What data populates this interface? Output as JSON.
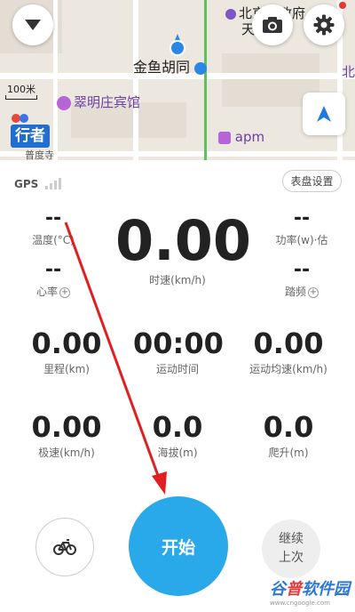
{
  "map": {
    "pois": {
      "beijing_gov": "北京市政府",
      "tianan": "天",
      "jinyu_hutong": "金鱼胡同",
      "cuiming_hotel": "翠明庄宾馆",
      "apm": "apm",
      "bei": "北",
      "puqian": "普度寺"
    },
    "scale": "100米",
    "logo": "行者",
    "icons": {
      "menu": "dropdown-arrow-icon",
      "camera": "camera-icon",
      "settings": "gear-icon",
      "locate": "navigation-arrow-icon",
      "location": "location-pin-icon"
    }
  },
  "panel": {
    "gps_label": "GPS",
    "dial_settings": "表盘设置",
    "metrics": {
      "temperature": {
        "value": "--",
        "label": "温度(°C)"
      },
      "heart_rate": {
        "value": "--",
        "label": "心率"
      },
      "speed": {
        "value": "0.00",
        "label": "时速(km/h)"
      },
      "power": {
        "value": "--",
        "label": "功率(w)·估"
      },
      "cadence": {
        "value": "--",
        "label": "踏频"
      },
      "distance": {
        "value": "0.00",
        "label": "里程(km)"
      },
      "moving_time": {
        "value": "00:00",
        "label": "运动时间"
      },
      "avg_speed": {
        "value": "0.00",
        "label": "运动均速(km/h)"
      },
      "max_speed": {
        "value": "0.00",
        "label": "极速(km/h)"
      },
      "altitude": {
        "value": "0.0",
        "label": "海拔(m)"
      },
      "climb": {
        "value": "0.0",
        "label": "爬升(m)"
      }
    },
    "start_label": "开始",
    "continue_line1": "继续",
    "continue_line2": "上次",
    "watermark": {
      "c1": "谷",
      "c2": "普",
      "c3": "软件园",
      "sub": "www.cngoogle.com"
    }
  },
  "colors": {
    "accent": "#29a8ea",
    "annotation_arrow": "#e02020",
    "map_bg": "#ece7df"
  }
}
